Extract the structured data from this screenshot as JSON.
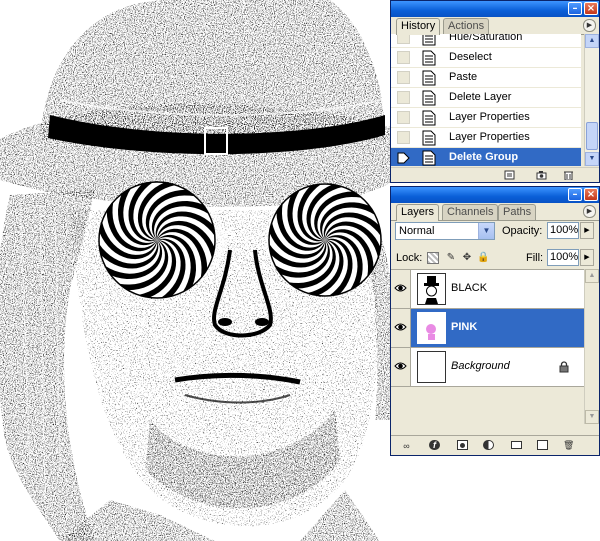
{
  "history_panel": {
    "tabs": [
      {
        "label": "History",
        "active": true
      },
      {
        "label": "Actions",
        "active": false
      }
    ],
    "items": [
      {
        "label": "Hue/Saturation",
        "selected": false
      },
      {
        "label": "Deselect",
        "selected": false
      },
      {
        "label": "Paste",
        "selected": false
      },
      {
        "label": "Delete Layer",
        "selected": false
      },
      {
        "label": "Layer Properties",
        "selected": false
      },
      {
        "label": "Layer Properties",
        "selected": false
      },
      {
        "label": "Delete Group",
        "selected": true
      }
    ],
    "icons": {
      "new_document": "new-document-icon",
      "snapshot": "camera-icon",
      "delete": "trash-icon"
    }
  },
  "layers_panel": {
    "tabs": [
      {
        "label": "Layers",
        "active": true
      },
      {
        "label": "Channels",
        "active": false
      },
      {
        "label": "Paths",
        "active": false
      }
    ],
    "blend_mode": "Normal",
    "opacity_label": "Opacity:",
    "opacity_value": "100%",
    "lock_label": "Lock:",
    "fill_label": "Fill:",
    "fill_value": "100%",
    "layers": [
      {
        "name": "BLACK",
        "visible": true,
        "selected": false,
        "locked": false
      },
      {
        "name": "PINK",
        "visible": true,
        "selected": true,
        "locked": false
      },
      {
        "name": "Background",
        "visible": true,
        "selected": false,
        "locked": true,
        "italic": true
      }
    ],
    "bottom_icons": [
      "link-icon",
      "layer-style-icon",
      "mask-icon",
      "adjustment-layer-icon",
      "folder-icon",
      "new-layer-icon",
      "trash-icon"
    ]
  },
  "colors": {
    "titlebar": "#0a5fd8",
    "selection": "#316ac5",
    "panel_bg": "#ece9d8"
  }
}
